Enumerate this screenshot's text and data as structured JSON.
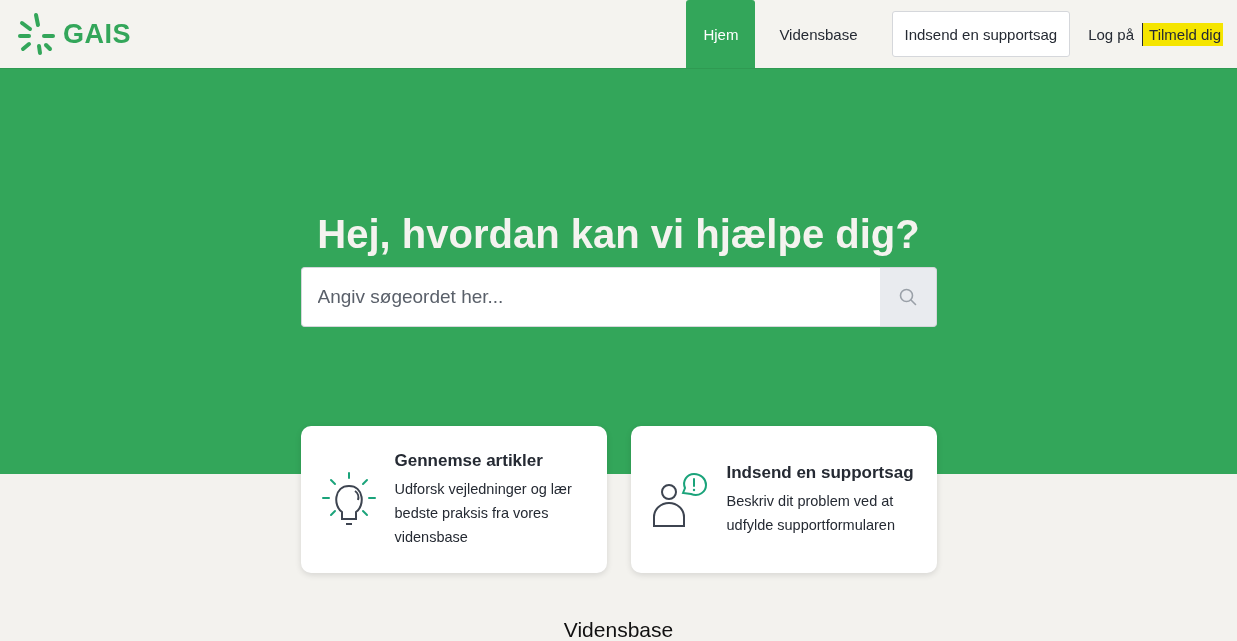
{
  "header": {
    "logo_text": "GAIS",
    "nav": [
      {
        "kind": "tab",
        "label": "Hjem",
        "selected": true
      },
      {
        "kind": "tab",
        "label": "Vidensbase",
        "selected": false
      },
      {
        "kind": "button",
        "label": "Indsend en supportsag"
      },
      {
        "kind": "link",
        "label": "Log på",
        "highlighted": false
      },
      {
        "kind": "link",
        "label": "Tilmeld dig",
        "highlighted": true
      }
    ]
  },
  "hero": {
    "title": "Hej, hvordan kan vi hjælpe dig?",
    "search": {
      "placeholder": "Angiv søgeordet her..."
    }
  },
  "cards": [
    {
      "kind": "lightbulb",
      "title": "Gennemse artikler",
      "text": "Udforsk vejledninger og lær bedste praksis fra vores vidensbase"
    },
    {
      "kind": "person",
      "title": "Indsend en supportsag",
      "text": "Beskriv dit problem ved at udfylde supportformularen"
    }
  ],
  "section_heading": "Vidensbase"
}
